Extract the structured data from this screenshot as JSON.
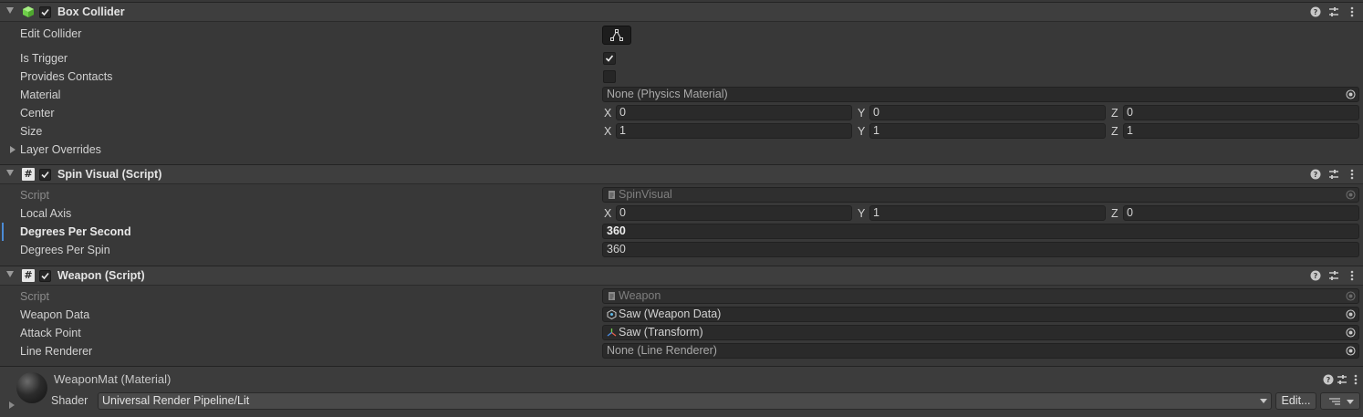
{
  "box_collider": {
    "title": "Box Collider",
    "rows": {
      "edit_collider": "Edit Collider",
      "is_trigger": "Is Trigger",
      "provides_contacts": "Provides Contacts",
      "material": "Material",
      "material_value": "None (Physics Material)",
      "center": "Center",
      "size": "Size",
      "layer_overrides": "Layer Overrides"
    },
    "is_trigger_checked": true,
    "provides_contacts_checked": false,
    "center": {
      "x": "0",
      "y": "0",
      "z": "0"
    },
    "size": {
      "x": "1",
      "y": "1",
      "z": "1"
    }
  },
  "axis_labels": {
    "x": "X",
    "y": "Y",
    "z": "Z"
  },
  "spin_visual": {
    "title": "Spin Visual (Script)",
    "script_label": "Script",
    "script_value": "SpinVisual",
    "local_axis_label": "Local Axis",
    "local_axis": {
      "x": "0",
      "y": "1",
      "z": "0"
    },
    "dps_label": "Degrees Per Second",
    "dps_value": "360",
    "dpspin_label": "Degrees Per Spin",
    "dpspin_value": "360"
  },
  "weapon": {
    "title": "Weapon (Script)",
    "script_label": "Script",
    "script_value": "Weapon",
    "weapon_data_label": "Weapon Data",
    "weapon_data_value": "Saw (Weapon Data)",
    "attack_point_label": "Attack Point",
    "attack_point_value": "Saw (Transform)",
    "line_renderer_label": "Line Renderer",
    "line_renderer_value": "None (Line Renderer)"
  },
  "material": {
    "title": "WeaponMat (Material)",
    "shader_label": "Shader",
    "shader_value": "Universal Render Pipeline/Lit",
    "edit_label": "Edit..."
  },
  "colors": {
    "background": "#383838",
    "header": "#3e3e3e",
    "field": "#2a2a2a",
    "accent": "#4b8bd6",
    "box_collider_icon": "#7ed957"
  },
  "icons": [
    "box-collider-icon",
    "script-hash-icon",
    "help-icon",
    "settings-icon",
    "more-icon",
    "object-picker-icon",
    "edit-collider-icon"
  ]
}
